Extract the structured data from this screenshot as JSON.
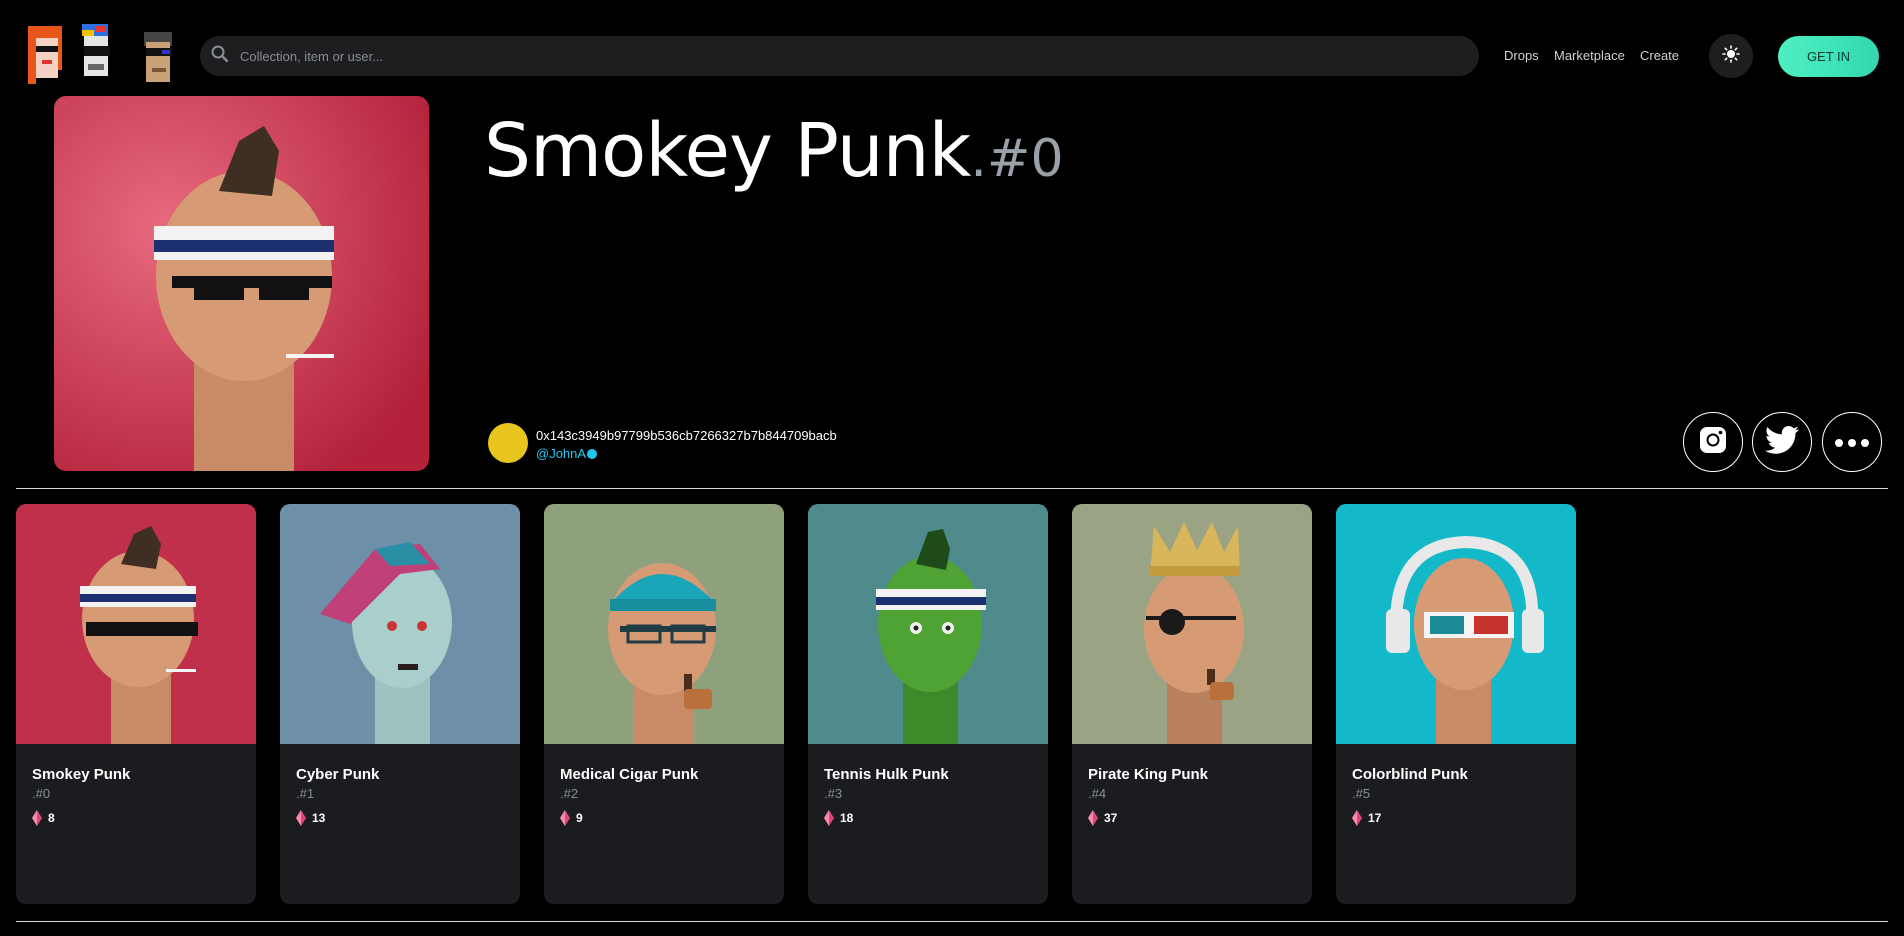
{
  "header": {
    "logo_icon": "pixel-punks-logo",
    "search": {
      "placeholder": "Collection, item or user..."
    },
    "nav": [
      "Drops",
      "Marketplace",
      "Create"
    ],
    "theme_icon": "sun-icon",
    "cta": "GET IN"
  },
  "item": {
    "name": "Smokey Punk",
    "number": ".#0",
    "owner": {
      "address": "0x143c3949b97799b536cb7266327b7b844709bacb",
      "handle": "@JohnA"
    },
    "social_icons": [
      "instagram-icon",
      "twitter-icon",
      "more-icon"
    ]
  },
  "cards": [
    {
      "name": "Smokey Punk",
      "number": ".#0",
      "price": "8",
      "bg": "#c0304a"
    },
    {
      "name": "Cyber Punk",
      "number": ".#1",
      "price": "13",
      "bg": "#6d8fa8"
    },
    {
      "name": "Medical Cigar Punk",
      "number": ".#2",
      "price": "9",
      "bg": "#8ea07c"
    },
    {
      "name": "Tennis Hulk Punk",
      "number": ".#3",
      "price": "18",
      "bg": "#4f8a8c"
    },
    {
      "name": "Pirate King Punk",
      "number": ".#4",
      "price": "37",
      "bg": "#9aa484"
    },
    {
      "name": "Colorblind Punk",
      "number": ".#5",
      "price": "17",
      "bg": "#13b9c8"
    }
  ],
  "colors": {
    "accent": "#4ef0c2",
    "card_bg": "#1b1c1f",
    "handle": "#1ec8f0",
    "price_icon": "#e0487a"
  }
}
